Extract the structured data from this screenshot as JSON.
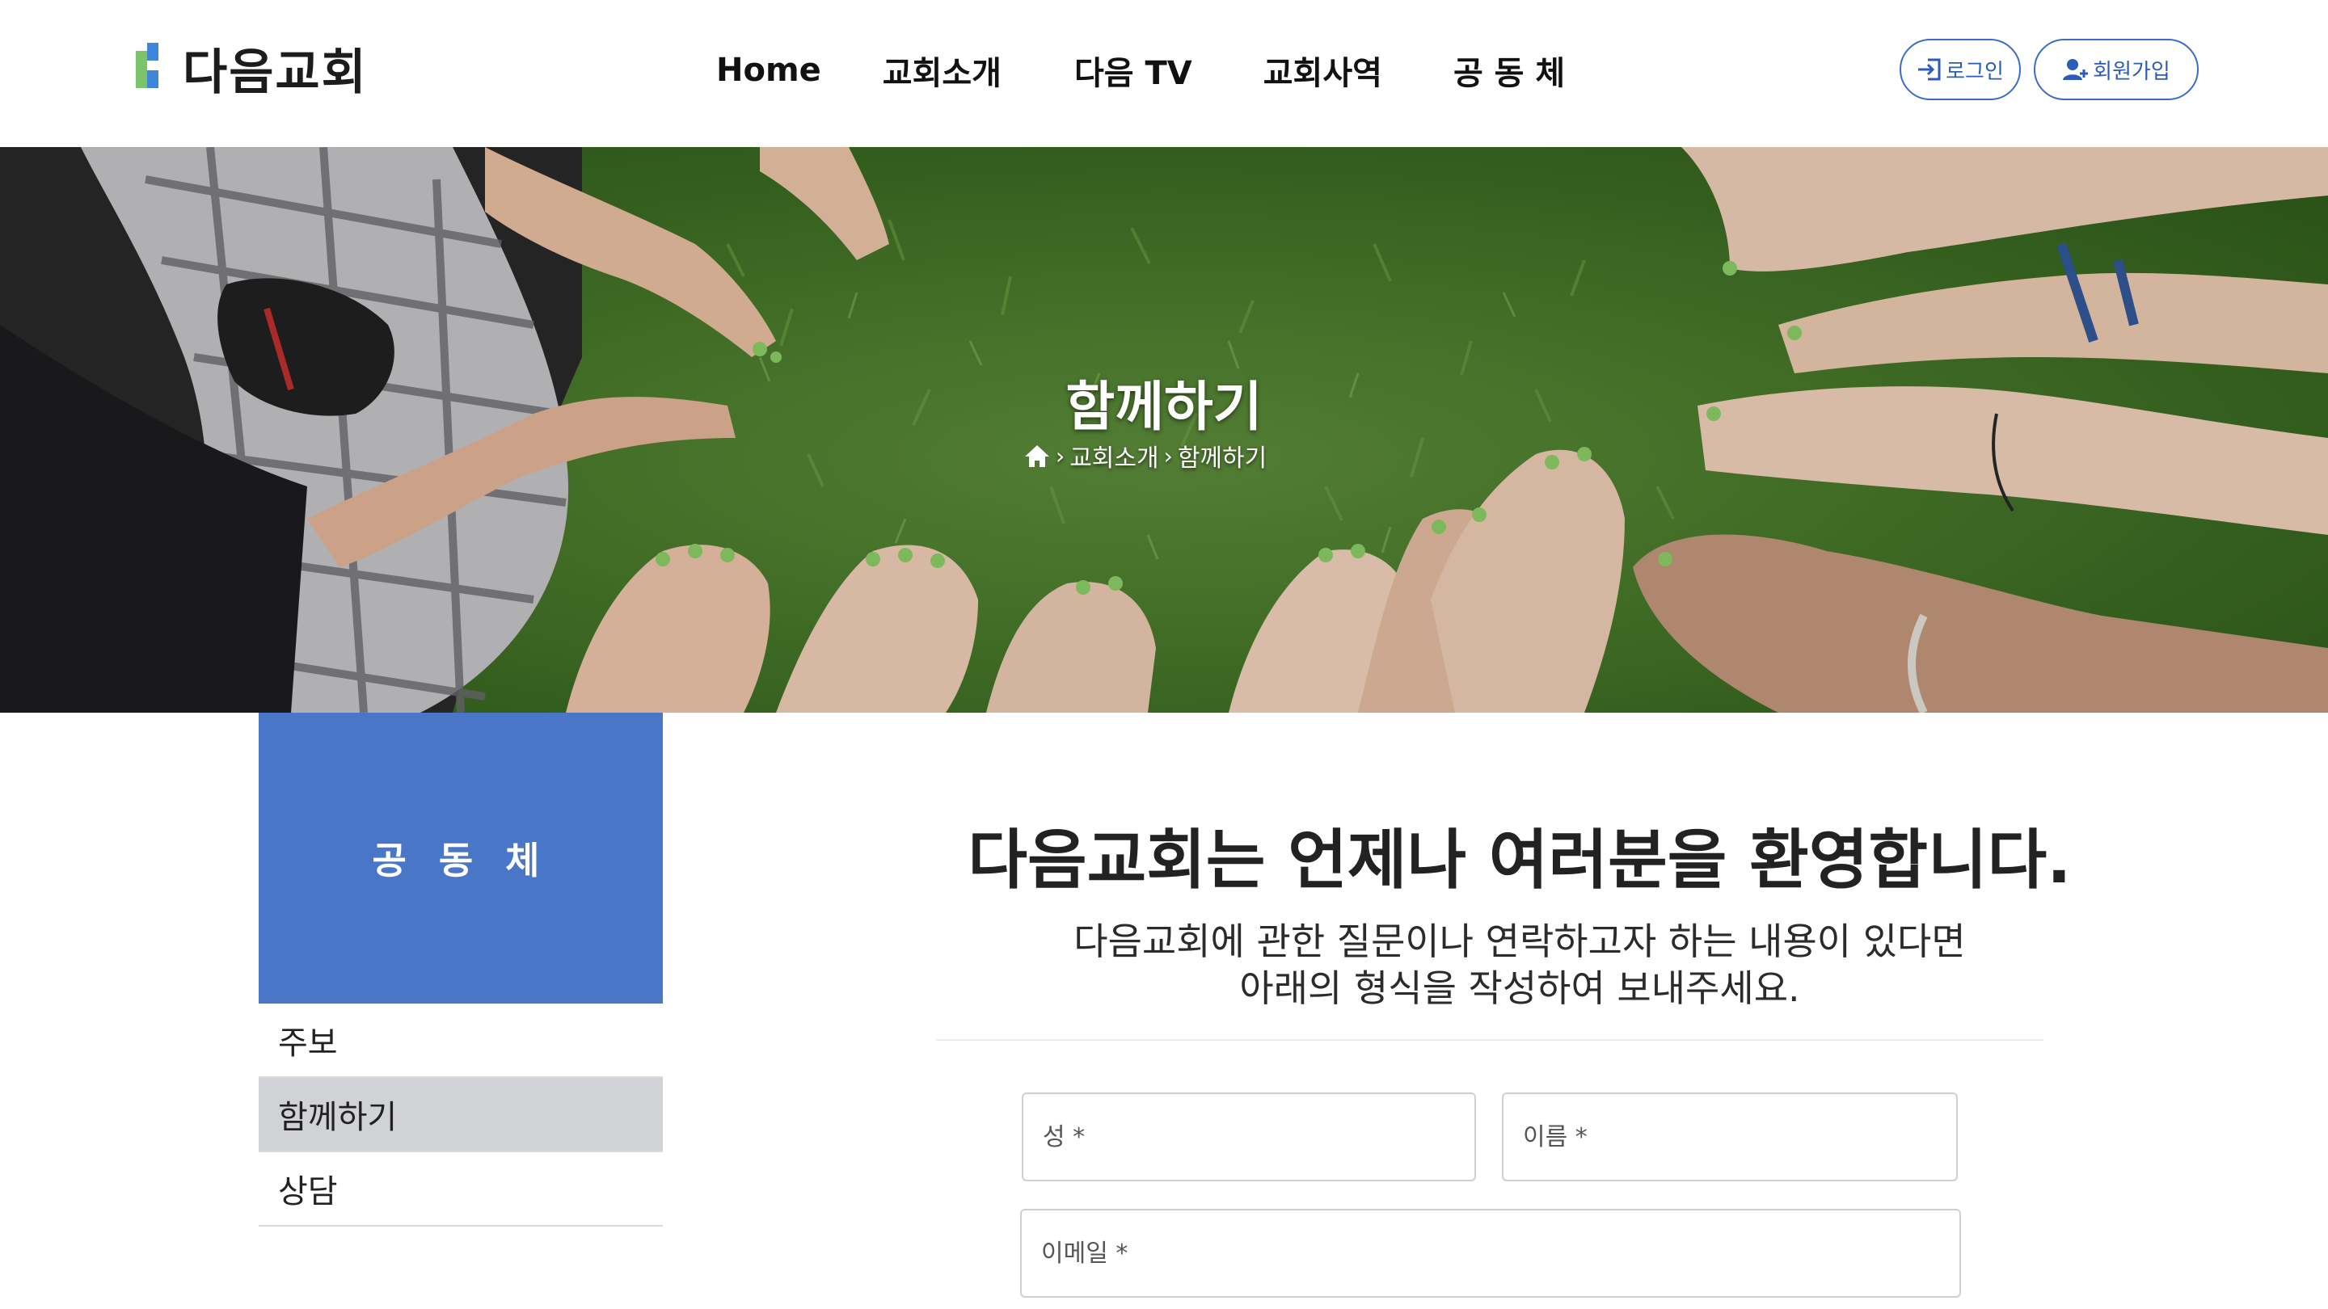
{
  "header": {
    "logo_text": "다음교회",
    "nav": [
      "Home",
      "교회소개",
      "다음 TV",
      "교회사역",
      "공 동 체"
    ],
    "login_label": "로그인",
    "signup_label": "회원가입"
  },
  "hero": {
    "title": "함께하기",
    "breadcrumb": [
      "교회소개",
      "함께하기"
    ]
  },
  "sidebar": {
    "title": "공 동 체",
    "items": [
      {
        "label": "주보"
      },
      {
        "label": "함께하기"
      },
      {
        "label": "상담"
      }
    ]
  },
  "main": {
    "title": "다음교회는 언제나 여러분을 환영합니다.",
    "subtitle_line1": "다음교회에 관한 질문이나 연락하고자 하는 내용이 있다면",
    "subtitle_line2": "아래의 형식을 작성하여 보내주세요."
  },
  "form": {
    "last_name_placeholder": "성 *",
    "first_name_placeholder": "이름 *",
    "email_placeholder": "이메일 *"
  },
  "colors": {
    "sidebar_accent": "#4a76c7",
    "active_item": "#d1d2d6",
    "button_border": "#3c6cc6"
  }
}
